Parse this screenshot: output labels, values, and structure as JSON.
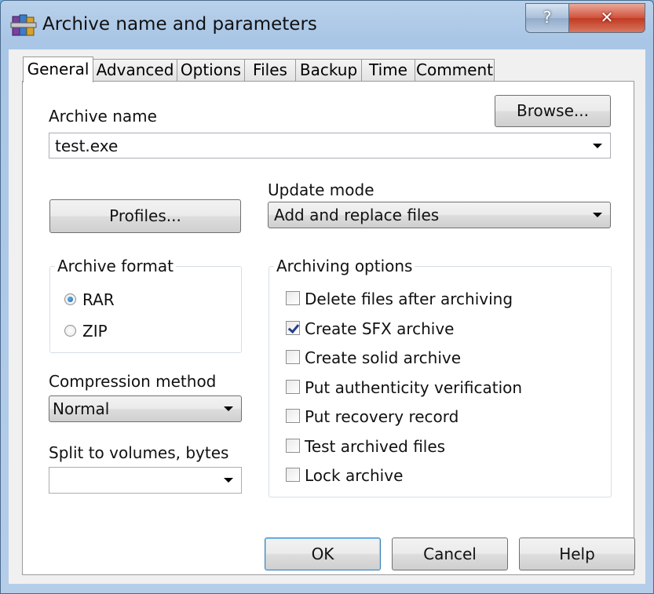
{
  "window": {
    "title": "Archive name and parameters",
    "help_glyph": "?",
    "close_glyph": "✕"
  },
  "tabs": [
    "General",
    "Advanced",
    "Options",
    "Files",
    "Backup",
    "Time",
    "Comment"
  ],
  "general": {
    "archive_name_label": "Archive name",
    "browse_label": "Browse...",
    "archive_name_value": "test.exe",
    "update_mode_label": "Update mode",
    "update_mode_value": "Add and replace files",
    "profiles_label": "Profiles...",
    "archive_format": {
      "title": "Archive format",
      "options": [
        "RAR",
        "ZIP"
      ],
      "selected": "RAR"
    },
    "compression_method_label": "Compression method",
    "compression_method_value": "Normal",
    "split_label": "Split to volumes, bytes",
    "split_value": "",
    "archiving_options": {
      "title": "Archiving options",
      "items": [
        {
          "label": "Delete files after archiving",
          "checked": false
        },
        {
          "label": "Create SFX archive",
          "checked": true
        },
        {
          "label": "Create solid archive",
          "checked": false
        },
        {
          "label": "Put authenticity verification",
          "checked": false
        },
        {
          "label": "Put recovery record",
          "checked": false
        },
        {
          "label": "Test archived files",
          "checked": false
        },
        {
          "label": "Lock archive",
          "checked": false
        }
      ]
    }
  },
  "buttons": {
    "ok": "OK",
    "cancel": "Cancel",
    "help": "Help"
  },
  "colors": {
    "accent": "#3c7fb1",
    "close_red": "#c13a22",
    "checkmark": "#27408b"
  }
}
